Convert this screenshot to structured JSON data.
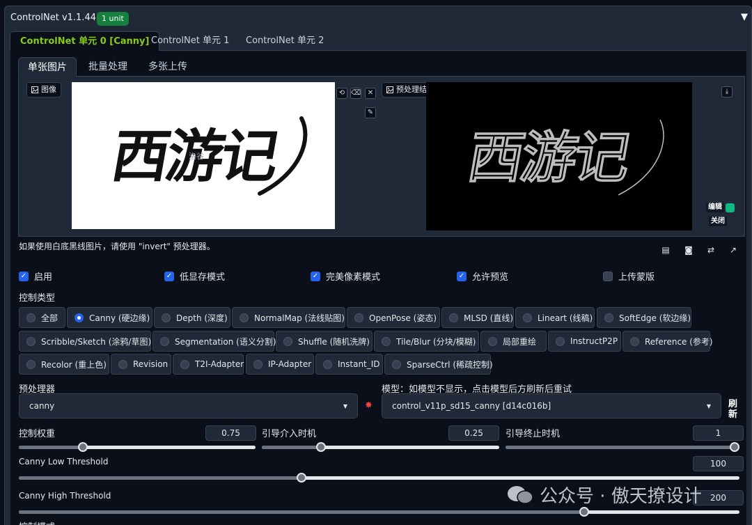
{
  "header": {
    "title": "ControlNet v1.1.441",
    "badge": "1 unit",
    "collapse_glyph": "▼"
  },
  "unit_tabs": [
    {
      "label": "ControlNet 单元 0 [Canny]",
      "active": true
    },
    {
      "label": "ControlNet 单元 1",
      "active": false
    },
    {
      "label": "ControlNet 单元 2",
      "active": false
    }
  ],
  "input_tabs": [
    {
      "label": "单张图片",
      "active": true
    },
    {
      "label": "批量处理",
      "active": false
    },
    {
      "label": "多张上传",
      "active": false
    }
  ],
  "image_panel": {
    "label": "图像",
    "calligraphy": "西游记",
    "overlay": "洛谷",
    "icon": "image-icon"
  },
  "preview_panel": {
    "label": "预处理结果预览",
    "calligraphy": "西游记",
    "edit": "编辑",
    "close": "关闭",
    "icon": "image-icon"
  },
  "hint": "如果使用白底黑线图片，请使用 \"invert\" 预处理器。",
  "checkboxes": [
    {
      "label": "启用",
      "checked": true
    },
    {
      "label": "低显存模式",
      "checked": true
    },
    {
      "label": "完美像素模式",
      "checked": true
    },
    {
      "label": "允许预览",
      "checked": true
    },
    {
      "label": "上传蒙版",
      "checked": false
    }
  ],
  "control_type": {
    "label": "控制类型",
    "options": [
      {
        "label": "全部",
        "selected": false
      },
      {
        "label": "Canny (硬边缘)",
        "selected": true
      },
      {
        "label": "Depth (深度)",
        "selected": false
      },
      {
        "label": "NormalMap (法线贴图)",
        "selected": false
      },
      {
        "label": "OpenPose (姿态)",
        "selected": false
      },
      {
        "label": "MLSD (直线)",
        "selected": false
      },
      {
        "label": "Lineart (线稿)",
        "selected": false
      },
      {
        "label": "SoftEdge (软边缘)",
        "selected": false
      },
      {
        "label": "Scribble/Sketch (涂鸦/草图)",
        "selected": false
      },
      {
        "label": "Segmentation (语义分割)",
        "selected": false
      },
      {
        "label": "Shuffle (随机洗牌)",
        "selected": false
      },
      {
        "label": "Tile/Blur (分块/模糊)",
        "selected": false
      },
      {
        "label": "局部重绘",
        "selected": false
      },
      {
        "label": "InstructP2P",
        "selected": false
      },
      {
        "label": "Reference (参考)",
        "selected": false
      },
      {
        "label": "Recolor (重上色)",
        "selected": false
      },
      {
        "label": "Revision",
        "selected": false
      },
      {
        "label": "T2I-Adapter",
        "selected": false
      },
      {
        "label": "IP-Adapter",
        "selected": false
      },
      {
        "label": "Instant_ID",
        "selected": false
      },
      {
        "label": "SparseCtrl (稀疏控制)",
        "selected": false
      }
    ]
  },
  "preprocessor": {
    "label": "预处理器",
    "value": "canny"
  },
  "model": {
    "label": "模型：如模型不显示，点击模型后方刷新后重试",
    "value": "control_v11p_sd15_canny [d14c016b]",
    "refresh": "刷新"
  },
  "sliders": {
    "weight": {
      "label": "控制权重",
      "value": "0.75",
      "fraction": 0.27
    },
    "start": {
      "label": "引导介入时机",
      "value": "0.25",
      "fraction": 0.25
    },
    "end": {
      "label": "引导终止时机",
      "value": "1",
      "fraction": 1.0
    },
    "low": {
      "label": "Canny Low Threshold",
      "value": "100",
      "fraction": 0.392
    },
    "high": {
      "label": "Canny High Threshold",
      "value": "200",
      "fraction": 0.785
    }
  },
  "next_label": "控制模式",
  "watermark": "公众号 · 傲天撩设计"
}
